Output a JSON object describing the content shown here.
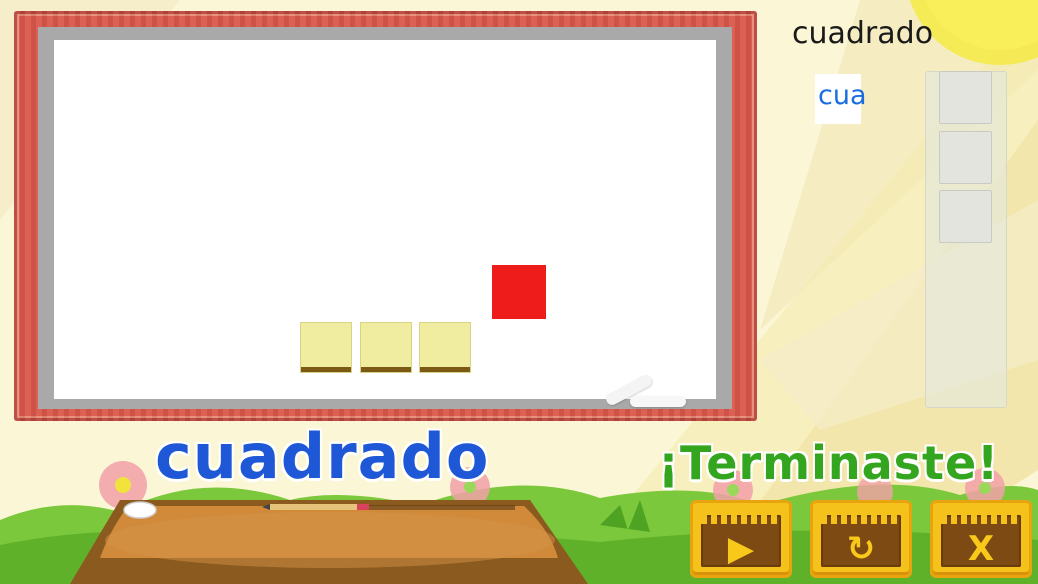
{
  "top_right": {
    "target_word": "cuadrado",
    "partial_word": "cua"
  },
  "bottom": {
    "word": "cuadrado",
    "finished_message": "¡Terminaste!"
  },
  "buttons": {
    "play": {
      "icon": "play-icon",
      "glyph": "▶"
    },
    "replay": {
      "icon": "replay-icon",
      "glyph": "↻"
    },
    "close": {
      "icon": "close-icon",
      "glyph": "X"
    }
  },
  "board": {
    "tile_count": 3,
    "slot_count": 3
  },
  "colors": {
    "frame": "#d9574a",
    "tile": "#f1eda0",
    "red_square": "#ee1c1b",
    "word_blue": "#1e58d6",
    "finished_green": "#34a51e",
    "button_yellow": "#f4c21a",
    "button_brown": "#7c4a12"
  }
}
